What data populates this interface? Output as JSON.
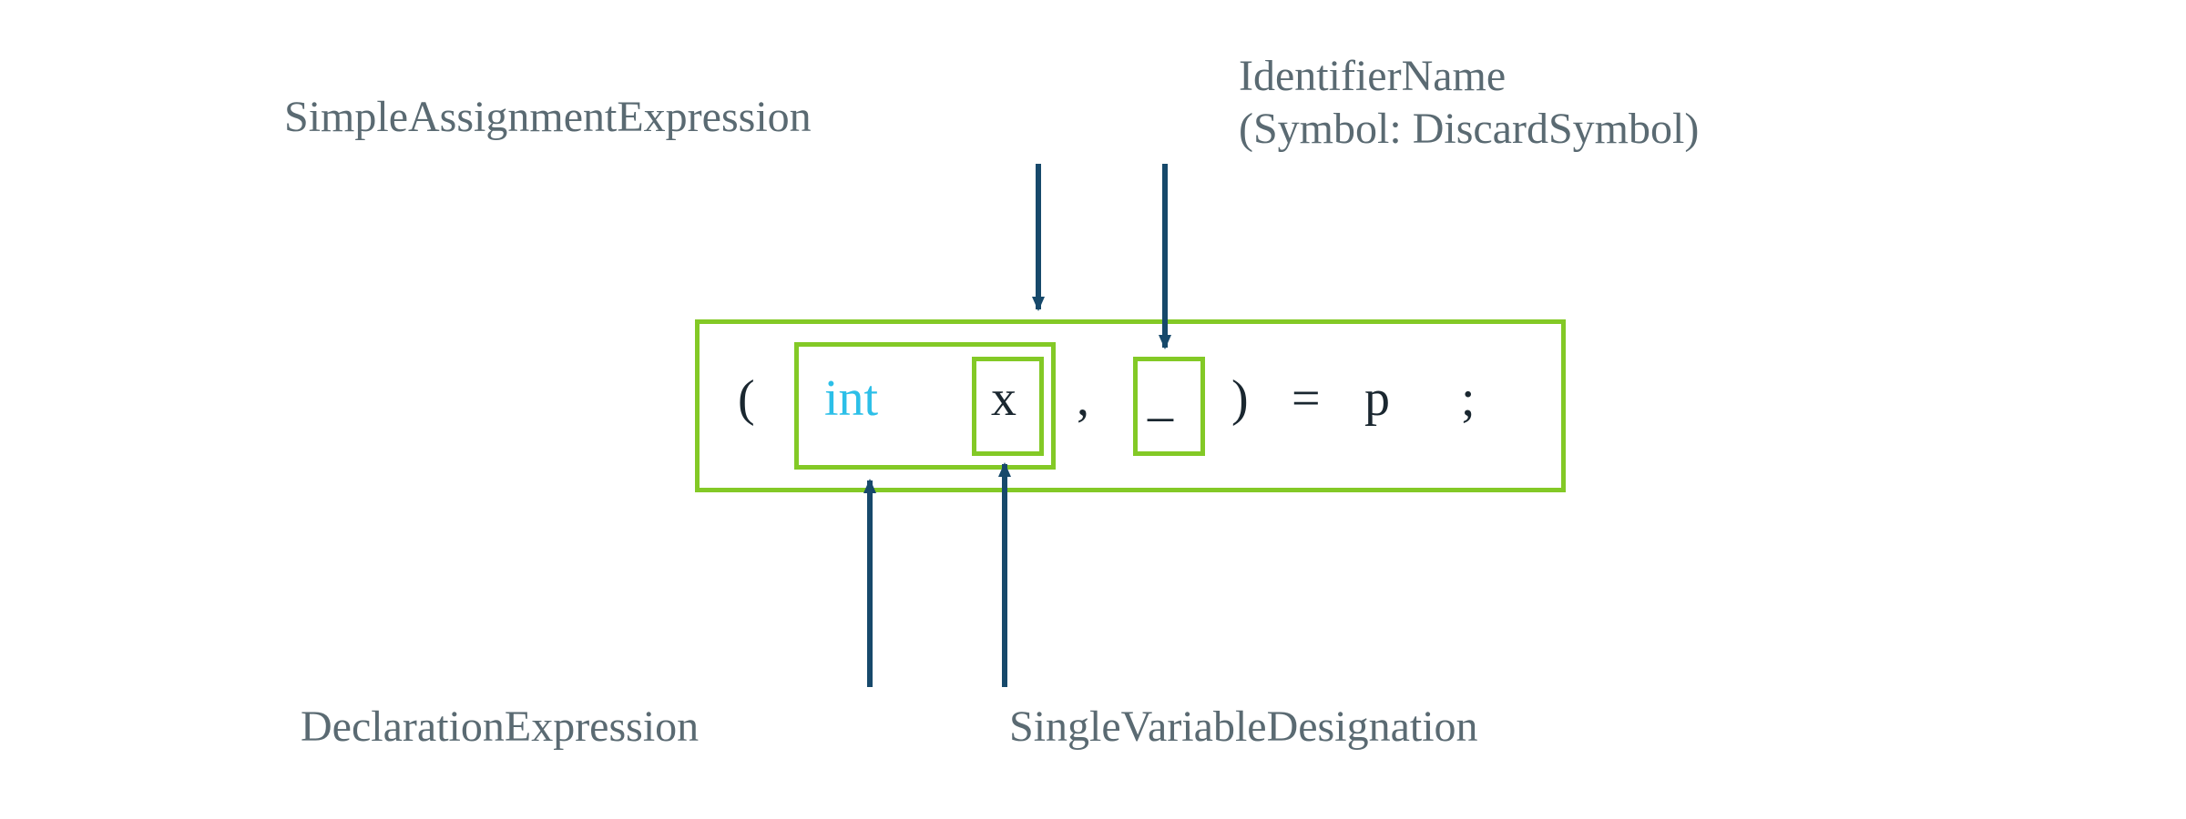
{
  "labels": {
    "simpleAssignment": "SimpleAssignmentExpression",
    "identifierName": "IdentifierName\n(Symbol: DiscardSymbol)",
    "declarationExpression": "DeclarationExpression",
    "singleVariableDesignation": "SingleVariableDesignation"
  },
  "code": {
    "open": "(",
    "int": "int",
    "x": "x",
    "comma": ",",
    "under": "_",
    "close": ")",
    "eq": "=",
    "p": "p",
    "semi": ";"
  },
  "colors": {
    "boxBorder": "#83c926",
    "arrow": "#17496b",
    "text": "#5a6a72",
    "keyword": "#2cbfe8",
    "token": "#1a2730"
  },
  "diagram": {
    "nodes": [
      {
        "id": "SimpleAssignmentExpression",
        "span": "( int x , _ ) = p"
      },
      {
        "id": "DeclarationExpression",
        "span": "int x"
      },
      {
        "id": "SingleVariableDesignation",
        "span": "x"
      },
      {
        "id": "IdentifierName",
        "span": "_",
        "symbol": "DiscardSymbol"
      }
    ],
    "arrows": [
      {
        "from": "SimpleAssignmentExpression-label",
        "to": "outer-box",
        "dir": "down"
      },
      {
        "from": "IdentifierName-label",
        "to": "discard-box",
        "dir": "down"
      },
      {
        "from": "DeclarationExpression-label",
        "to": "decl-box",
        "dir": "up"
      },
      {
        "from": "SingleVariableDesignation-label",
        "to": "svd-box",
        "dir": "up"
      }
    ]
  }
}
